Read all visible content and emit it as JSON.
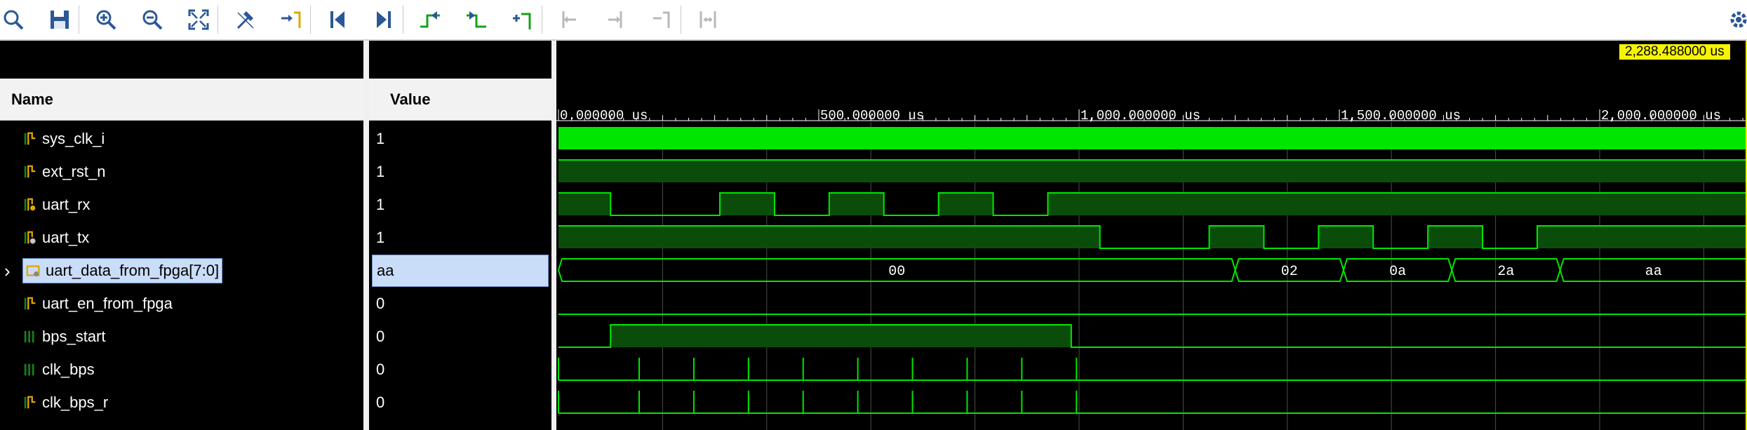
{
  "toolbar": {
    "buttons": [
      {
        "name": "search-icon"
      },
      {
        "name": "save-icon"
      },
      {
        "name": "zoom-in-icon"
      },
      {
        "name": "zoom-out-icon"
      },
      {
        "name": "zoom-fit-icon"
      },
      {
        "name": "snap-cursor-icon"
      },
      {
        "name": "go-to-cursor-icon"
      },
      {
        "name": "go-to-time-zero-icon"
      },
      {
        "name": "go-to-last-time-icon"
      },
      {
        "name": "previous-transition-icon"
      },
      {
        "name": "next-transition-icon"
      },
      {
        "name": "add-marker-icon"
      },
      {
        "name": "previous-marker-icon"
      },
      {
        "name": "next-marker-icon"
      },
      {
        "name": "remove-marker-icon"
      },
      {
        "name": "swap-cursors-icon"
      },
      {
        "name": "settings-icon"
      }
    ]
  },
  "columns": {
    "name": "Name",
    "value": "Value"
  },
  "cursor_time": "2,288.488000 us",
  "signals": [
    {
      "name": "sys_clk_i",
      "value": "1",
      "kind": "clock",
      "icon": "bit-signal-icon"
    },
    {
      "name": "ext_rst_n",
      "value": "1",
      "kind": "bit",
      "icon": "bit-signal-icon"
    },
    {
      "name": "uart_rx",
      "value": "1",
      "kind": "bit",
      "icon": "input-signal-icon"
    },
    {
      "name": "uart_tx",
      "value": "1",
      "kind": "bit",
      "icon": "output-signal-icon"
    },
    {
      "name": "uart_data_from_fpga[7:0]",
      "value": "aa",
      "kind": "bus",
      "icon": "bus-signal-icon",
      "selected": true,
      "expandable": true
    },
    {
      "name": "uart_en_from_fpga",
      "value": "0",
      "kind": "bit",
      "icon": "bit-signal-icon"
    },
    {
      "name": "bps_start",
      "value": "0",
      "kind": "bit",
      "icon": "register-signal-icon"
    },
    {
      "name": "clk_bps",
      "value": "0",
      "kind": "bit",
      "icon": "register-signal-icon"
    },
    {
      "name": "clk_bps_r",
      "value": "0",
      "kind": "bit",
      "icon": "bit-signal-icon"
    }
  ],
  "time_axis": {
    "unit": "us",
    "ticks": [
      {
        "t": 0,
        "label": "0.000000 us"
      },
      {
        "t": 500,
        "label": "500.000000 us"
      },
      {
        "t": 1000,
        "label": "1,000.000000 us"
      },
      {
        "t": 1500,
        "label": "1,500.000000 us"
      },
      {
        "t": 2000,
        "label": "2,000.000000 us"
      }
    ],
    "range_us": [
      0,
      2288.488
    ]
  },
  "waves": [
    {
      "signal": "sys_clk_i",
      "type": "clock"
    },
    {
      "signal": "ext_rst_n",
      "type": "bit",
      "initial": 1,
      "edges": []
    },
    {
      "signal": "uart_rx",
      "type": "bit",
      "initial": 1,
      "edges": [
        100,
        310,
        415,
        520,
        625,
        730,
        835,
        940
      ]
    },
    {
      "signal": "uart_tx",
      "type": "bit",
      "initial": 1,
      "edges": [
        1040,
        1250,
        1355,
        1460,
        1565,
        1670,
        1775,
        1880
      ]
    },
    {
      "signal": "uart_data_from_fpga[7:0]",
      "type": "bus",
      "segments": [
        {
          "from": 0,
          "to": 1300,
          "value": "00"
        },
        {
          "from": 1300,
          "to": 1508,
          "value": "02"
        },
        {
          "from": 1508,
          "to": 1716,
          "value": "0a"
        },
        {
          "from": 1716,
          "to": 1924,
          "value": "2a"
        },
        {
          "from": 1924,
          "to": 2288.488,
          "value": "aa"
        }
      ]
    },
    {
      "signal": "uart_en_from_fpga",
      "type": "bit",
      "initial": 0,
      "edges": []
    },
    {
      "signal": "bps_start",
      "type": "bit",
      "initial": 0,
      "edges": [
        100,
        985
      ]
    },
    {
      "signal": "clk_bps",
      "type": "pulses",
      "at": [
        155,
        260,
        365,
        470,
        575,
        680,
        785,
        890,
        995
      ]
    },
    {
      "signal": "clk_bps_r",
      "type": "pulses",
      "at": [
        155,
        260,
        365,
        470,
        575,
        680,
        785,
        890,
        995
      ]
    }
  ],
  "colors": {
    "wave": "#00e600",
    "wave_fill_high": "#0a4d0a",
    "grid": "#4d4d4d",
    "cursor": "#f6f400",
    "selection": "#c9dcf8"
  }
}
